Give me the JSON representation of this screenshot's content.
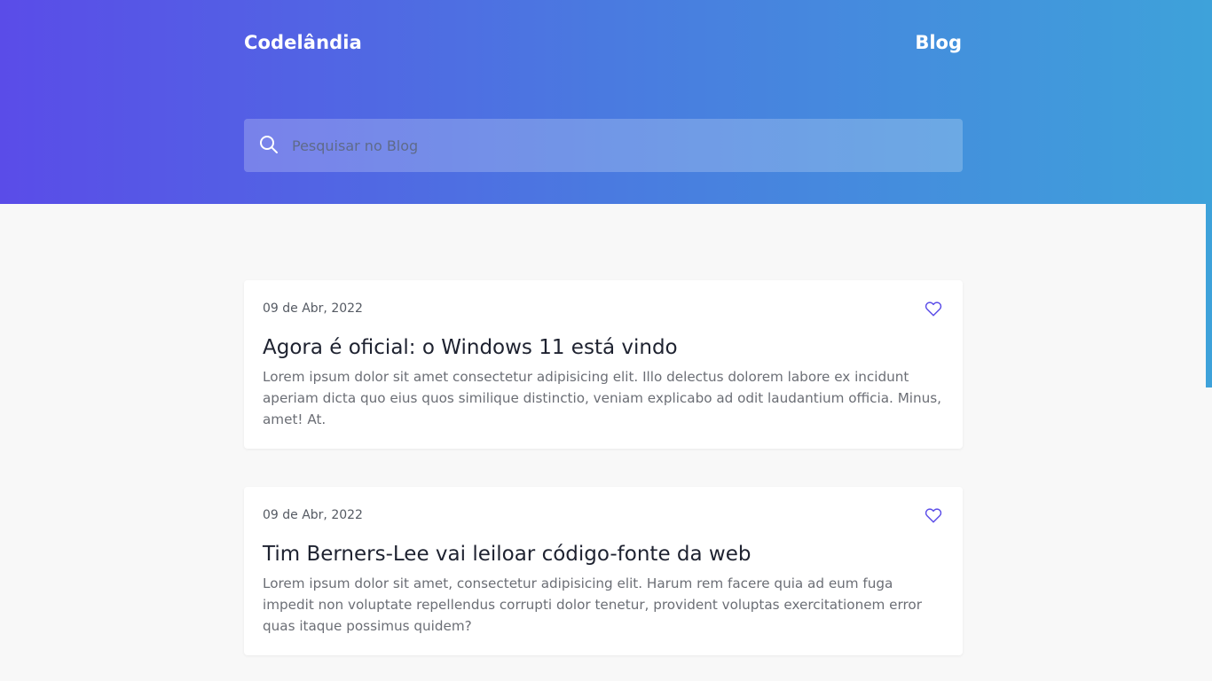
{
  "header": {
    "brand": "Codelândia",
    "nav_blog": "Blog"
  },
  "search": {
    "placeholder": "Pesquisar no Blog",
    "value": ""
  },
  "colors": {
    "gradient_start": "#5a4ce8",
    "gradient_end": "#3ea2da",
    "accent": "#5a4ce8"
  },
  "posts": [
    {
      "date": "09 de Abr, 2022",
      "title": "Agora é oficial: o Windows 11 está vindo",
      "excerpt": "Lorem ipsum dolor sit amet consectetur adipisicing elit. Illo delectus dolorem labore ex incidunt aperiam dicta quo eius quos similique distinctio, veniam explicabo ad odit laudantium officia. Minus, amet! At.",
      "icon": "heart-outline-icon"
    },
    {
      "date": "09 de Abr, 2022",
      "title": "Tim Berners-Lee vai leiloar código-fonte da web",
      "excerpt": "Lorem ipsum dolor sit amet, consectetur adipisicing elit. Harum rem facere quia ad eum fuga impedit non voluptate repellendus corrupti dolor tenetur, provident voluptas exercitationem error quas itaque possimus quidem?",
      "icon": "heart-outline-icon"
    }
  ]
}
